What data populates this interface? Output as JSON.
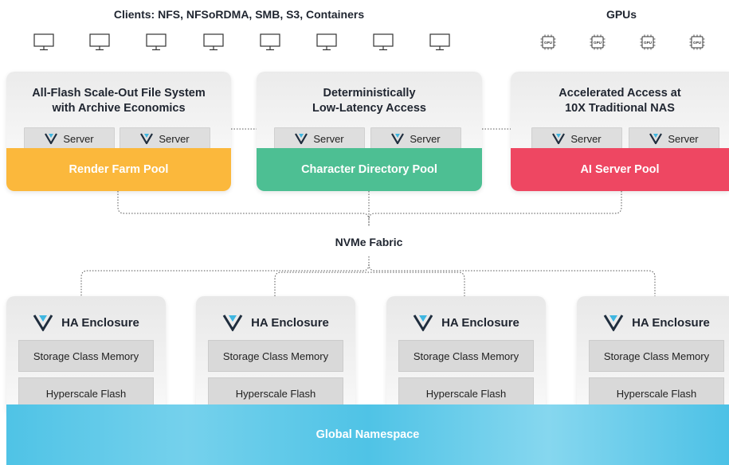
{
  "header": {
    "clients_label": "Clients: NFS, NFSoRDMA, SMB, S3, Containers",
    "gpus_label": "GPUs",
    "client_icon": "monitor-icon",
    "gpu_icon": "gpu-chip-icon",
    "gpu_chip_text": "GPU"
  },
  "top_cards": [
    {
      "title_line1": "All-Flash Scale-Out File System",
      "title_line2": "with Archive Economics",
      "servers": [
        "Server",
        "Server"
      ],
      "pool": "Render Farm Pool",
      "pool_color": "#fbb83c"
    },
    {
      "title_line1": "Deterministically",
      "title_line2": "Low-Latency Access",
      "servers": [
        "Server",
        "Server"
      ],
      "pool": "Character Directory Pool",
      "pool_color": "#4dbf93"
    },
    {
      "title_line1": "Accelerated Access at",
      "title_line2": "10X Traditional NAS",
      "servers": [
        "Server",
        "Server"
      ],
      "pool": "AI Server Pool",
      "pool_color": "#ee4762"
    }
  ],
  "fabric_label": "NVMe Fabric",
  "enclosures": [
    {
      "title": "HA Enclosure",
      "layer1": "Storage Class Memory",
      "layer2": "Hyperscale Flash"
    },
    {
      "title": "HA Enclosure",
      "layer1": "Storage Class Memory",
      "layer2": "Hyperscale Flash"
    },
    {
      "title": "HA Enclosure",
      "layer1": "Storage Class Memory",
      "layer2": "Hyperscale Flash"
    },
    {
      "title": "HA Enclosure",
      "layer1": "Storage Class Memory",
      "layer2": "Hyperscale Flash"
    }
  ],
  "namespace_label": "Global Namespace",
  "colors": {
    "logo_dark": "#1f2d3d",
    "logo_accent": "#3fb6e0",
    "connector": "#555555"
  }
}
